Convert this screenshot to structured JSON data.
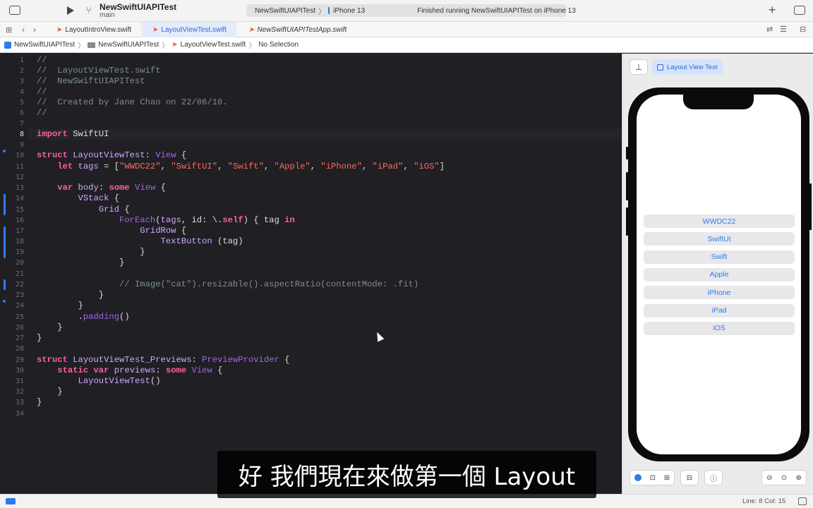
{
  "toolbar": {
    "project_name": "NewSwiftUIAPITest",
    "branch": "main",
    "scheme_target": "NewSwiftUIAPITest",
    "device": "iPhone 13",
    "status": "Finished running NewSwiftUIAPITest on iPhone 13",
    "add_label": "+"
  },
  "tabs": [
    {
      "label": "LayoutIntroView.swift"
    },
    {
      "label": "LayoutViewTest.swift"
    },
    {
      "label": "NewSwiftUIAPITestApp.swift"
    }
  ],
  "breadcrumb": [
    "NewSwiftUIAPITest",
    "NewSwiftUIAPITest",
    "LayoutViewTest.swift",
    "No Selection"
  ],
  "editor": {
    "line_numbers": [
      "1",
      "2",
      "3",
      "4",
      "5",
      "6",
      "7",
      "8",
      "9",
      "10",
      "11",
      "12",
      "13",
      "14",
      "15",
      "16",
      "17",
      "18",
      "19",
      "20",
      "21",
      "22",
      "23",
      "24",
      "25",
      "26",
      "27",
      "28",
      "29",
      "30",
      "31",
      "32",
      "33",
      "34"
    ],
    "current_line": "8"
  },
  "preview": {
    "chip_label": "Layout View Test",
    "tags": [
      "WWDC22",
      "SwiftUI",
      "Swift",
      "Apple",
      "iPhone",
      "iPad",
      "iOS"
    ]
  },
  "status_bar": {
    "position": "Line: 8  Col: 15"
  },
  "subtitle": "好 我們現在來做第一個 Layout",
  "colors": {
    "accent": "#2f7be6",
    "editor_bg": "#1f1f24",
    "keyword": "#fc5fa3",
    "string": "#fc6a5d",
    "comment": "#7f8c98"
  }
}
